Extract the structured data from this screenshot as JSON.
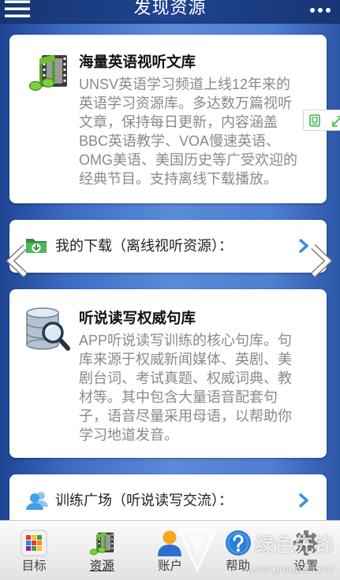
{
  "header": {
    "title": "发现资源",
    "menu_icon": "menu-icon",
    "more_icon": "more-dots-icon"
  },
  "cards": [
    {
      "icon": "music-film-icon",
      "title": "海量英语视听文库",
      "lines": [
        "UNSV英语学习频道上线12年来的",
        "英语学习资源库。多达数万篇视听",
        "文章，保持每日更新，内容涵盖",
        "BBC英语教学、VOA慢速英语、",
        "OMG美语、美国历史等广受欢迎的",
        "经典节目。支持离线下载播放。"
      ]
    },
    {
      "icon": "database-search-icon",
      "title": "听说读写权威句库",
      "lines": [
        "APP听说读写训练的核心句库。句",
        "库来源于权威新闻媒体、英剧、美",
        "剧台词、考试真题、权威词典、教",
        "材等。其中包含大量语音配套句",
        "子，语音尽量采用母语，以帮助你",
        "学习地道发音。"
      ]
    }
  ],
  "links": [
    {
      "icon": "download-folder-icon",
      "label": "我的下载（离线视听资源）："
    },
    {
      "icon": "people-icon",
      "label": "训练广场（听说读写交流）："
    }
  ],
  "carousel": {
    "prev_icon": "chevron-left-icon",
    "next_icon": "chevron-right-icon"
  },
  "float_tools": {
    "icons": [
      "reader-mode-icon",
      "expand-icon"
    ]
  },
  "nav": {
    "items": [
      {
        "label": "目标",
        "icon": "grid-icon",
        "active": false
      },
      {
        "label": "资源",
        "icon": "music-film-icon",
        "active": true
      },
      {
        "label": "账户",
        "icon": "user-icon",
        "active": false
      },
      {
        "label": "帮助",
        "icon": "help-icon",
        "active": false
      },
      {
        "label": "设置",
        "icon": "gear-icon",
        "active": false
      }
    ]
  },
  "watermark": {
    "name": "绿色先锋",
    "url": "www.greenxf.com"
  },
  "colors": {
    "header_bg": "#1c3c84",
    "background": "#4a7bcf",
    "card_bg": "#ffffff",
    "title_text": "#111111",
    "description_text": "#8a8a8a",
    "chevron": "#3b8fe0",
    "nav_bg": "#ececec"
  }
}
